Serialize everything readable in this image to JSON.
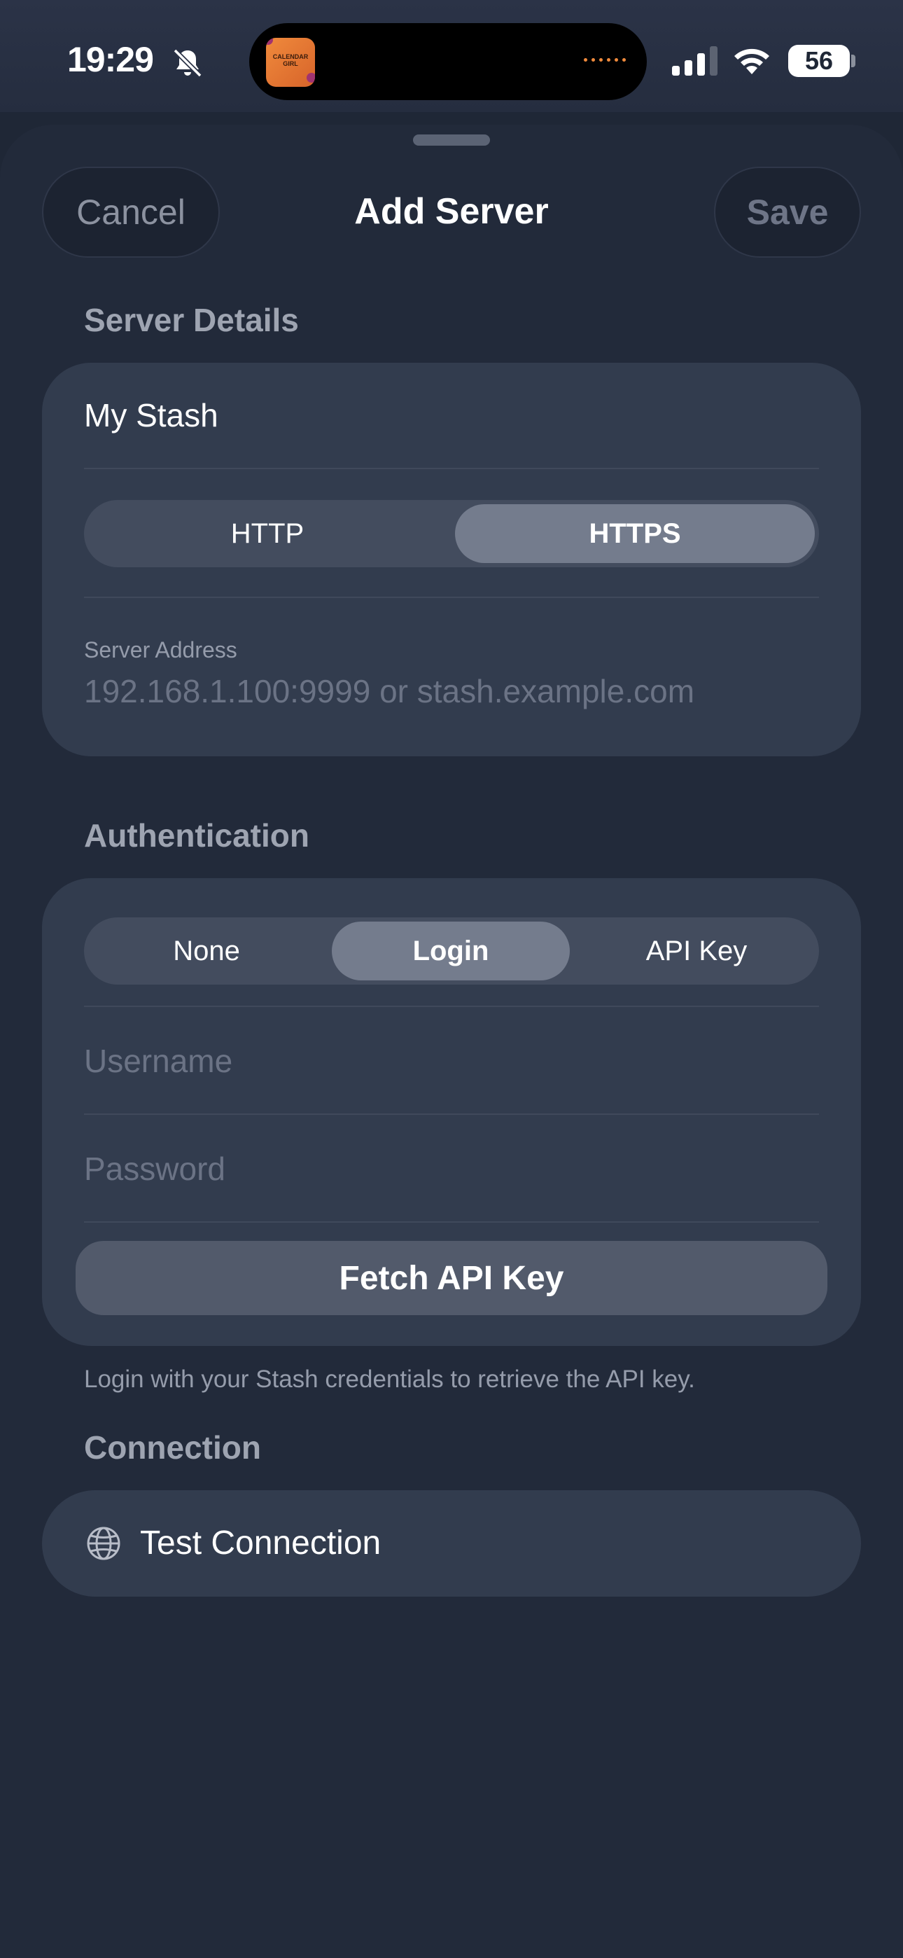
{
  "status_bar": {
    "time": "19:29",
    "battery": "56",
    "island_app_label": "CALENDAR GIRL",
    "icons": [
      "bell-slash-icon",
      "cellular-signal-icon",
      "wifi-icon",
      "battery-icon"
    ]
  },
  "nav": {
    "cancel_label": "Cancel",
    "title": "Add Server",
    "save_label": "Save"
  },
  "server_details": {
    "header": "Server Details",
    "name_value": "My Stash",
    "protocol_options": [
      "HTTP",
      "HTTPS"
    ],
    "protocol_selected": "HTTPS",
    "address_label": "Server Address",
    "address_placeholder": "192.168.1.100:9999 or stash.example.com"
  },
  "authentication": {
    "header": "Authentication",
    "options": [
      "None",
      "Login",
      "API Key"
    ],
    "selected": "Login",
    "username_placeholder": "Username",
    "password_placeholder": "Password",
    "fetch_label": "Fetch API Key",
    "footer": "Login with your Stash credentials to retrieve the API key."
  },
  "connection": {
    "header": "Connection",
    "test_label": "Test Connection",
    "test_icon": "globe-icon"
  },
  "colors": {
    "background": "#1f2736",
    "card": "#323c4e",
    "segment_track": "#434c5e",
    "segment_selected": "#747c8d",
    "secondary_text": "#9ea4b1",
    "accent_orange": "#f08a3c"
  }
}
